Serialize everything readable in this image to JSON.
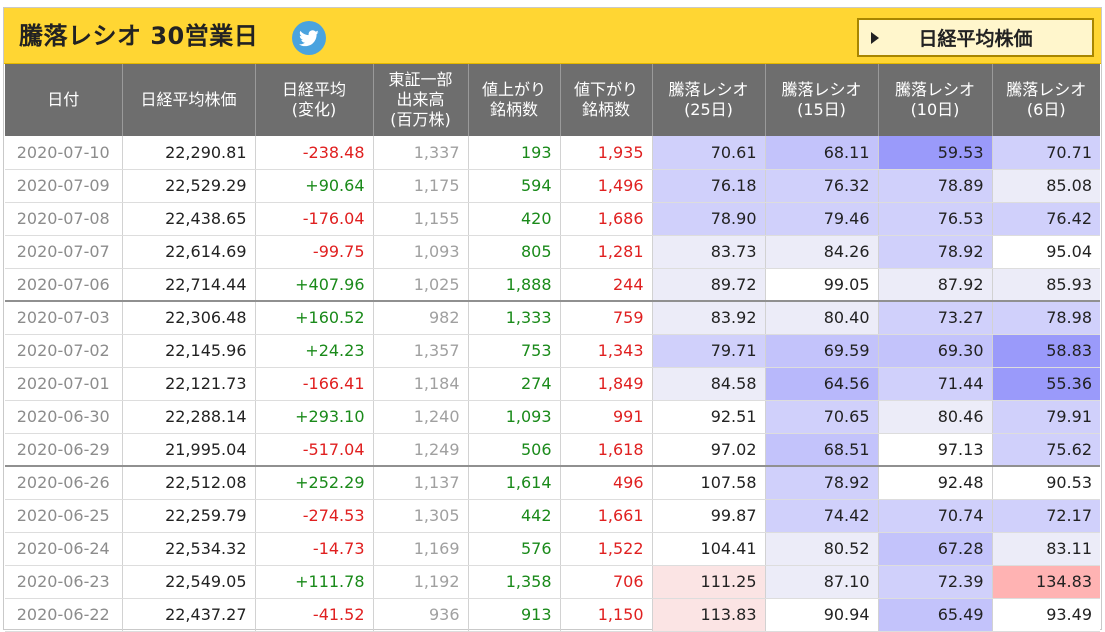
{
  "header": {
    "title": "騰落レシオ 30営業日",
    "nikkei_button": "日経平均株価"
  },
  "columns": [
    "日付",
    "日経平均株価",
    "日経平均\n(変化)",
    "東証一部\n出来高\n(百万株)",
    "値上がり\n銘柄数",
    "値下がり\n銘柄数",
    "騰落レシオ\n(25日)",
    "騰落レシオ\n(15日)",
    "騰落レシオ\n(10日)",
    "騰落レシオ\n(6日)"
  ],
  "rows": [
    {
      "date": "2020-07-10",
      "close": "22,290.81",
      "change": "-238.48",
      "volume": "1,337",
      "adv": "193",
      "dec": "1,935",
      "r25": "70.61",
      "r15": "68.11",
      "r10": "59.53",
      "r6": "70.71"
    },
    {
      "date": "2020-07-09",
      "close": "22,529.29",
      "change": "+90.64",
      "volume": "1,175",
      "adv": "594",
      "dec": "1,496",
      "r25": "76.18",
      "r15": "76.32",
      "r10": "78.89",
      "r6": "85.08"
    },
    {
      "date": "2020-07-08",
      "close": "22,438.65",
      "change": "-176.04",
      "volume": "1,155",
      "adv": "420",
      "dec": "1,686",
      "r25": "78.90",
      "r15": "79.46",
      "r10": "76.53",
      "r6": "76.42"
    },
    {
      "date": "2020-07-07",
      "close": "22,614.69",
      "change": "-99.75",
      "volume": "1,093",
      "adv": "805",
      "dec": "1,281",
      "r25": "83.73",
      "r15": "84.26",
      "r10": "78.92",
      "r6": "95.04"
    },
    {
      "date": "2020-07-06",
      "close": "22,714.44",
      "change": "+407.96",
      "volume": "1,025",
      "adv": "1,888",
      "dec": "244",
      "r25": "89.72",
      "r15": "99.05",
      "r10": "87.92",
      "r6": "85.93"
    },
    {
      "date": "2020-07-03",
      "close": "22,306.48",
      "change": "+160.52",
      "volume": "982",
      "adv": "1,333",
      "dec": "759",
      "r25": "83.92",
      "r15": "80.40",
      "r10": "73.27",
      "r6": "78.98"
    },
    {
      "date": "2020-07-02",
      "close": "22,145.96",
      "change": "+24.23",
      "volume": "1,357",
      "adv": "753",
      "dec": "1,343",
      "r25": "79.71",
      "r15": "69.59",
      "r10": "69.30",
      "r6": "58.83"
    },
    {
      "date": "2020-07-01",
      "close": "22,121.73",
      "change": "-166.41",
      "volume": "1,184",
      "adv": "274",
      "dec": "1,849",
      "r25": "84.58",
      "r15": "64.56",
      "r10": "71.44",
      "r6": "55.36"
    },
    {
      "date": "2020-06-30",
      "close": "22,288.14",
      "change": "+293.10",
      "volume": "1,240",
      "adv": "1,093",
      "dec": "991",
      "r25": "92.51",
      "r15": "70.65",
      "r10": "80.46",
      "r6": "79.91"
    },
    {
      "date": "2020-06-29",
      "close": "21,995.04",
      "change": "-517.04",
      "volume": "1,249",
      "adv": "506",
      "dec": "1,618",
      "r25": "97.02",
      "r15": "68.51",
      "r10": "97.13",
      "r6": "75.62"
    },
    {
      "date": "2020-06-26",
      "close": "22,512.08",
      "change": "+252.29",
      "volume": "1,137",
      "adv": "1,614",
      "dec": "496",
      "r25": "107.58",
      "r15": "78.92",
      "r10": "92.48",
      "r6": "90.53"
    },
    {
      "date": "2020-06-25",
      "close": "22,259.79",
      "change": "-274.53",
      "volume": "1,305",
      "adv": "442",
      "dec": "1,661",
      "r25": "99.87",
      "r15": "74.42",
      "r10": "70.74",
      "r6": "72.17"
    },
    {
      "date": "2020-06-24",
      "close": "22,534.32",
      "change": "-14.73",
      "volume": "1,169",
      "adv": "576",
      "dec": "1,522",
      "r25": "104.41",
      "r15": "80.52",
      "r10": "67.28",
      "r6": "83.11"
    },
    {
      "date": "2020-06-23",
      "close": "22,549.05",
      "change": "+111.78",
      "volume": "1,192",
      "adv": "1,358",
      "dec": "706",
      "r25": "111.25",
      "r15": "87.10",
      "r10": "72.39",
      "r6": "134.83"
    },
    {
      "date": "2020-06-22",
      "close": "22,437.27",
      "change": "-41.52",
      "volume": "936",
      "adv": "913",
      "dec": "1,150",
      "r25": "113.83",
      "r15": "90.94",
      "r10": "65.49",
      "r6": "93.49"
    }
  ],
  "colors": {
    "header_bg": "#ffd633",
    "table_header_bg": "#6e6e6e",
    "positive": "#1a8a1a",
    "negative": "#e02020"
  }
}
